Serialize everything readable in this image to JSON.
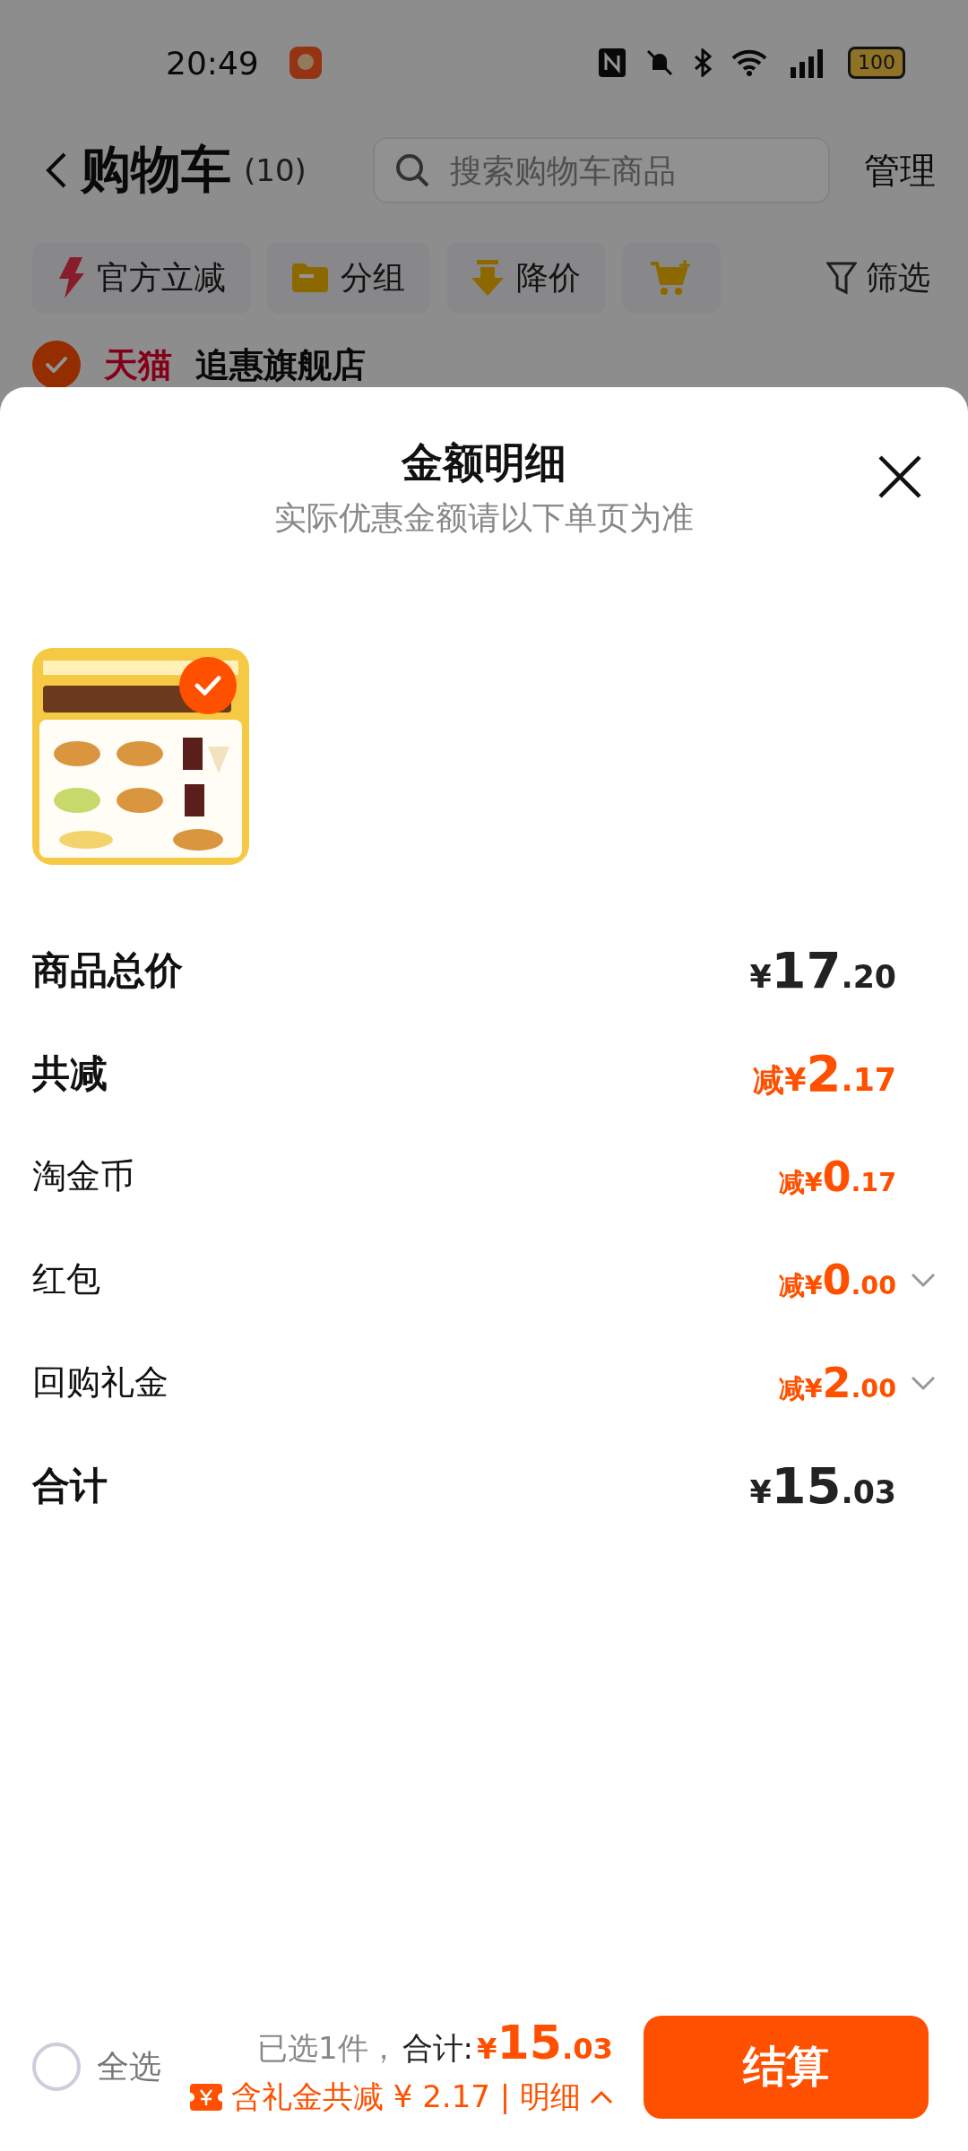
{
  "status_bar": {
    "time": "20:49",
    "battery": "100"
  },
  "header": {
    "title": "购物车",
    "count": "(10)",
    "search": {
      "placeholder": "搜索购物车商品"
    },
    "manage": "管理"
  },
  "chips": [
    {
      "kind": "flash",
      "label": "官方立减"
    },
    {
      "kind": "folder",
      "label": "分组"
    },
    {
      "kind": "price-drop",
      "label": "降价"
    },
    {
      "kind": "cart-add"
    }
  ],
  "filter": "筛选",
  "store": {
    "checked": true,
    "platform": "天猫",
    "name": "追惠旗舰店"
  },
  "sheet": {
    "title": "金额明细",
    "subtitle": "实际优惠金额请以下单页为准",
    "products": [
      {
        "kind": "picture",
        "selected": true
      }
    ],
    "rows": [
      {
        "kind": "total",
        "label": "商品总价",
        "value": "¥17.20",
        "expandable": false
      },
      {
        "kind": "discount",
        "label": "共减",
        "value": "减¥2.17",
        "expandable": false
      },
      {
        "kind": "item",
        "label": "淘金币",
        "value": "减¥0.17",
        "expandable": false
      },
      {
        "kind": "item",
        "label": "红包",
        "value": "减¥0.00",
        "expandable": true
      },
      {
        "kind": "item",
        "label": "回购礼金",
        "value": "减¥2.00",
        "expandable": true
      },
      {
        "kind": "total",
        "label": "合计",
        "value": "¥15.03",
        "expandable": false
      }
    ]
  },
  "bottom_bar": {
    "select_all": {
      "label": "全选",
      "checked": false
    },
    "selected_count": "已选1件，",
    "total_label": "合计:",
    "total": "¥15.03",
    "discount_note": "含礼金共减 ¥ 2.17 | 明细",
    "checkout": "结算"
  }
}
